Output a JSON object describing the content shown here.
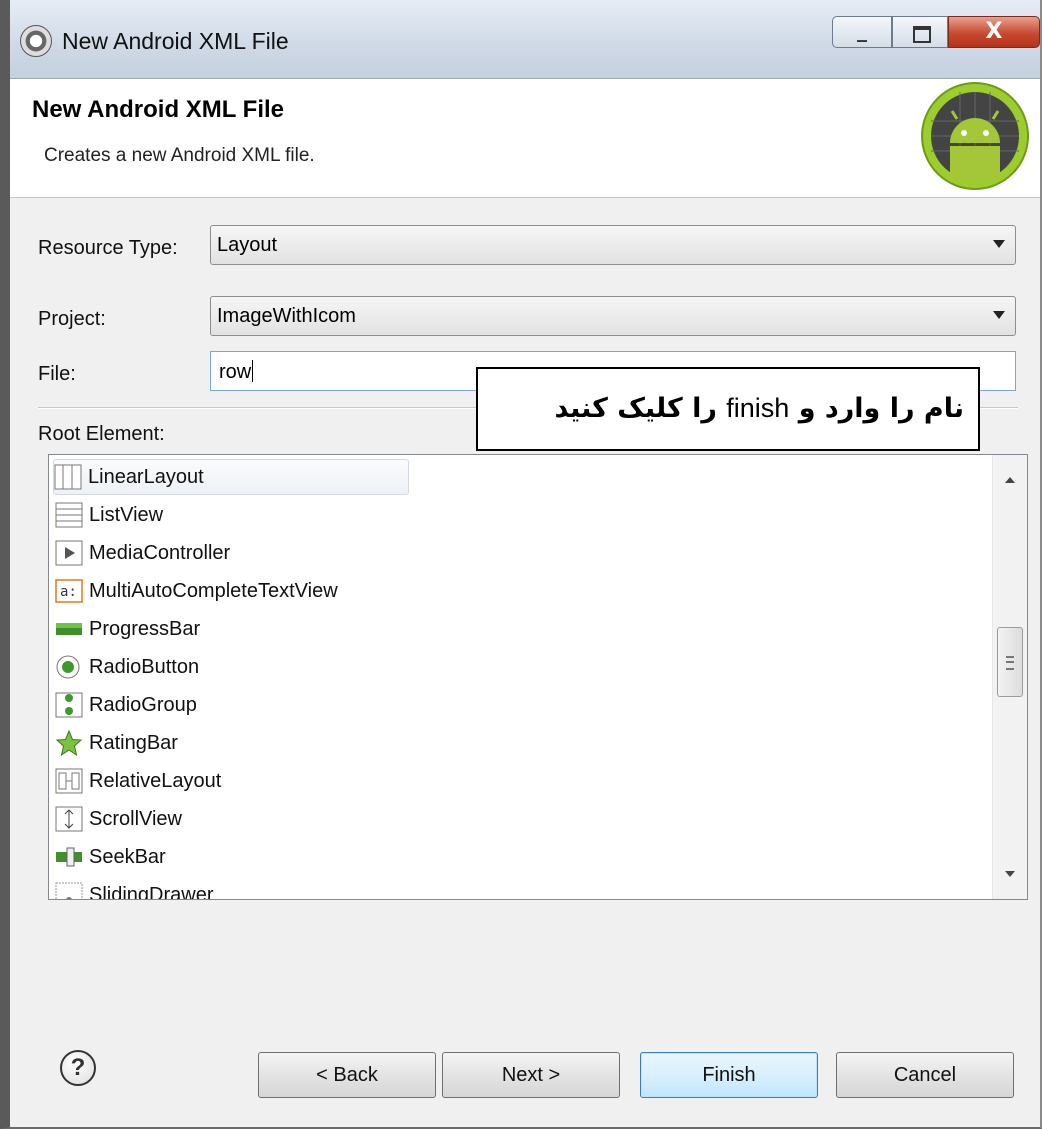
{
  "window": {
    "title": "New Android XML File",
    "min_glyph": "_",
    "close_glyph": "X"
  },
  "banner": {
    "title": "New Android XML File",
    "subtitle": "Creates a new Android XML file."
  },
  "form": {
    "resource_type_label": "Resource Type:",
    "resource_type_value": "Layout",
    "project_label": "Project:",
    "project_value": "ImageWithIcom",
    "file_label": "File:",
    "file_value": "row",
    "root_element_label": "Root Element:"
  },
  "root_elements": [
    {
      "label": "LinearLayout",
      "icon": "linear-layout-icon",
      "selected": true
    },
    {
      "label": "ListView",
      "icon": "list-view-icon"
    },
    {
      "label": "MediaController",
      "icon": "media-controller-icon"
    },
    {
      "label": "MultiAutoCompleteTextView",
      "icon": "text-view-icon"
    },
    {
      "label": "ProgressBar",
      "icon": "progress-bar-icon"
    },
    {
      "label": "RadioButton",
      "icon": "radio-button-icon"
    },
    {
      "label": "RadioGroup",
      "icon": "radio-group-icon"
    },
    {
      "label": "RatingBar",
      "icon": "star-icon"
    },
    {
      "label": "RelativeLayout",
      "icon": "relative-layout-icon"
    },
    {
      "label": "ScrollView",
      "icon": "scroll-view-icon"
    },
    {
      "label": "SeekBar",
      "icon": "seek-bar-icon"
    },
    {
      "label": "SlidingDrawer",
      "icon": "sliding-drawer-icon"
    }
  ],
  "annotation": {
    "part1": "نام را وارد و ",
    "part2": "finish",
    "part3": " را کلیک کنید"
  },
  "buttons": {
    "help": "?",
    "back": "< Back",
    "next": "Next >",
    "finish": "Finish",
    "cancel": "Cancel"
  },
  "colors": {
    "close_button": "#c74a31",
    "finish_button_border": "#3c7fb1",
    "android_green": "#97c024"
  }
}
